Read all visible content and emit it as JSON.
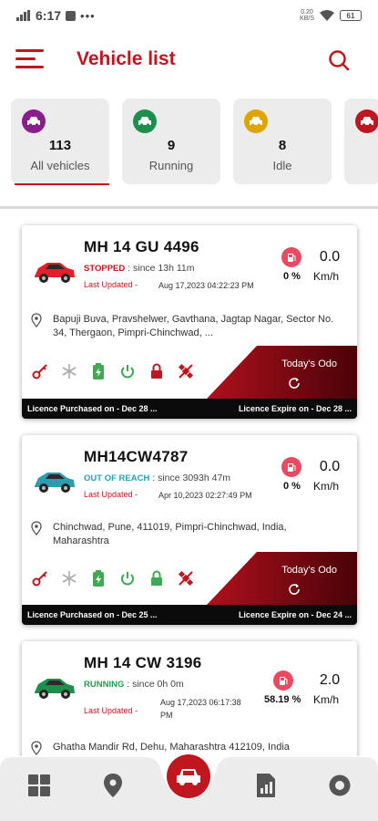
{
  "status_bar": {
    "time": "6:17",
    "speed_top": "0.20",
    "speed_bottom": "KB/S",
    "battery": "61"
  },
  "header": {
    "title": "Vehicle list"
  },
  "filters": [
    {
      "count": "113",
      "label": "All vehicles",
      "icon": "car-icon",
      "color": "#8a1c8d",
      "active": true
    },
    {
      "count": "9",
      "label": "Running",
      "icon": "car-icon",
      "color": "#1e8e4c"
    },
    {
      "count": "8",
      "label": "Idle",
      "icon": "car-icon",
      "color": "#e0a400"
    },
    {
      "count": "",
      "label": "",
      "icon": "car-icon",
      "color": "#c0161f"
    }
  ],
  "vehicles": [
    {
      "number": "MH 14 GU 4496",
      "status": "STOPPED",
      "status_color": "#c0161f",
      "since": " : since 13h 11m",
      "updated_label": "Last Updated -",
      "updated_date": "Aug 17,2023 04:22:23 PM",
      "fuel_pct": "0 %",
      "speed": "0.0",
      "speed_unit": "Km/h",
      "car_color": "#e0202a",
      "address": "Bapuji Buva, Pravshelwer, Gavthana, Jagtap Nagar, Sector No. 34, Thergaon, Pimpri-Chinchwad, ...",
      "odo_label": "Today's Odo",
      "licence_purchased": "Licence Purchased on - Dec 28 ...",
      "licence_expire": "Licence Expire on - Dec 28 ..."
    },
    {
      "number": "MH14CW4787",
      "status": "OUT OF REACH",
      "status_color": "#23a3b5",
      "since": " : since 3093h 47m",
      "updated_label": "Last Updated -",
      "updated_date": "Apr 10,2023 02:27:49 PM",
      "fuel_pct": "0 %",
      "speed": "0.0",
      "speed_unit": "Km/h",
      "car_color": "#2a9db0",
      "address": "Chinchwad, Pune, 411019, Pimpri-Chinchwad, India, Maharashtra",
      "odo_label": "Today's Odo",
      "licence_purchased": "Licence Purchased on - Dec 25 ...",
      "licence_expire": "Licence Expire on - Dec 24 ..."
    },
    {
      "number": "MH 14 CW 3196",
      "status": "RUNNING",
      "status_color": "#1e9e4c",
      "since": " : since 0h 0m",
      "updated_label": "Last Updated -",
      "updated_date": "Aug 17,2023 06:17:38",
      "updated_date2": "PM",
      "fuel_pct": "58.19 %",
      "speed": "2.0",
      "speed_unit": "Km/h",
      "car_color": "#1e8e4c",
      "address": "Ghatha Mandir Rd, Dehu, Maharashtra 412109, India"
    }
  ],
  "colors": {
    "accent": "#c0161f"
  }
}
